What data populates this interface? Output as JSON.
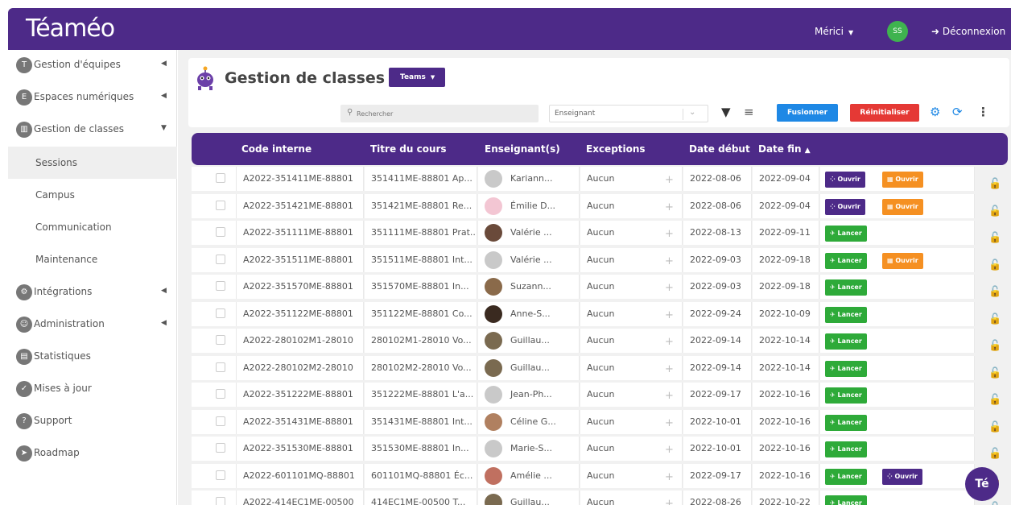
{
  "header": {
    "logo": "Téaméo",
    "user": "Mérici",
    "avatar_initials": "SS",
    "logout": "Déconnexion"
  },
  "sidebar": {
    "items": [
      {
        "label": "Gestion d'équipes",
        "icon": "team-icon"
      },
      {
        "label": "Espaces numériques",
        "icon": "spaces-icon"
      },
      {
        "label": "Gestion de classes",
        "icon": "class-icon"
      },
      {
        "label": "Sessions"
      },
      {
        "label": "Campus"
      },
      {
        "label": "Communication"
      },
      {
        "label": "Maintenance"
      },
      {
        "label": "Intégrations",
        "icon": "integrations-icon"
      },
      {
        "label": "Administration",
        "icon": "user-icon"
      },
      {
        "label": "Statistiques",
        "icon": "stats-icon"
      },
      {
        "label": "Mises à jour",
        "icon": "check-icon"
      },
      {
        "label": "Support",
        "icon": "help-icon"
      },
      {
        "label": "Roadmap",
        "icon": "roadmap-icon"
      }
    ]
  },
  "toolbar": {
    "title": "Gestion de classes",
    "teams_label": "Teams",
    "search_placeholder": "Rechercher",
    "teacher_select": "Enseignant",
    "merge_label": "Fusionner",
    "reset_label": "Réinitialiser"
  },
  "table": {
    "headers": [
      "Code interne",
      "Titre du cours",
      "Enseignant(s)",
      "Exceptions",
      "Date début",
      "Date fin"
    ],
    "sort_indicator": "▲",
    "rows": [
      {
        "code": "A2022-351411ME-88801",
        "title": "351411ME-88801 Ap...",
        "teacher": "Kariann...",
        "exc": "Aucun",
        "start": "2022-08-06",
        "end": "2022-09-04",
        "actions": [
          {
            "label": "Ouvrir",
            "kind": "purple"
          },
          {
            "label": "Ouvrir",
            "kind": "orange"
          }
        ]
      },
      {
        "code": "A2022-351421ME-88801",
        "title": "351421ME-88801 Re...",
        "teacher": "Émilie D...",
        "exc": "Aucun",
        "start": "2022-08-06",
        "end": "2022-09-04",
        "actions": [
          {
            "label": "Ouvrir",
            "kind": "purple"
          },
          {
            "label": "Ouvrir",
            "kind": "orange"
          }
        ]
      },
      {
        "code": "A2022-351111ME-88801",
        "title": "351111ME-88801 Prat...",
        "teacher": "Valérie ...",
        "exc": "Aucun",
        "start": "2022-08-13",
        "end": "2022-09-11",
        "actions": [
          {
            "label": "Lancer",
            "kind": "green"
          }
        ]
      },
      {
        "code": "A2022-351511ME-88801",
        "title": "351511ME-88801 Int...",
        "teacher": "Valérie ...",
        "exc": "Aucun",
        "start": "2022-09-03",
        "end": "2022-09-18",
        "actions": [
          {
            "label": "Lancer",
            "kind": "green"
          },
          {
            "label": "Ouvrir",
            "kind": "orange"
          }
        ]
      },
      {
        "code": "A2022-351570ME-88801",
        "title": "351570ME-88801 In...",
        "teacher": "Suzann...",
        "exc": "Aucun",
        "start": "2022-09-03",
        "end": "2022-09-18",
        "actions": [
          {
            "label": "Lancer",
            "kind": "green"
          }
        ]
      },
      {
        "code": "A2022-351122ME-88801",
        "title": "351122ME-88801 Co...",
        "teacher": "Anne-S...",
        "exc": "Aucun",
        "start": "2022-09-24",
        "end": "2022-10-09",
        "actions": [
          {
            "label": "Lancer",
            "kind": "green"
          }
        ]
      },
      {
        "code": "A2022-280102M1-28010",
        "title": "280102M1-28010 Vo...",
        "teacher": "Guillau...",
        "exc": "Aucun",
        "start": "2022-09-14",
        "end": "2022-10-14",
        "actions": [
          {
            "label": "Lancer",
            "kind": "green"
          }
        ]
      },
      {
        "code": "A2022-280102M2-28010",
        "title": "280102M2-28010 Vo...",
        "teacher": "Guillau...",
        "exc": "Aucun",
        "start": "2022-09-14",
        "end": "2022-10-14",
        "actions": [
          {
            "label": "Lancer",
            "kind": "green"
          }
        ]
      },
      {
        "code": "A2022-351222ME-88801",
        "title": "351222ME-88801 L'a...",
        "teacher": "Jean-Ph...",
        "exc": "Aucun",
        "start": "2022-09-17",
        "end": "2022-10-16",
        "actions": [
          {
            "label": "Lancer",
            "kind": "green"
          }
        ]
      },
      {
        "code": "A2022-351431ME-88801",
        "title": "351431ME-88801 Int...",
        "teacher": "Céline G...",
        "exc": "Aucun",
        "start": "2022-10-01",
        "end": "2022-10-16",
        "actions": [
          {
            "label": "Lancer",
            "kind": "green"
          }
        ]
      },
      {
        "code": "A2022-351530ME-88801",
        "title": "351530ME-88801 In...",
        "teacher": "Marie-S...",
        "exc": "Aucun",
        "start": "2022-10-01",
        "end": "2022-10-16",
        "actions": [
          {
            "label": "Lancer",
            "kind": "green"
          }
        ]
      },
      {
        "code": "A2022-601101MQ-88801",
        "title": "601101MQ-88801 Éc...",
        "teacher": "Amélie ...",
        "exc": "Aucun",
        "start": "2022-09-17",
        "end": "2022-10-16",
        "actions": [
          {
            "label": "Lancer",
            "kind": "green"
          },
          {
            "label": "Ouvrir",
            "kind": "purple"
          }
        ]
      },
      {
        "code": "A2022-414EC1ME-00500",
        "title": "414EC1ME-00500 T...",
        "teacher": "Guillau...",
        "exc": "Aucun",
        "start": "2022-08-26",
        "end": "2022-10-22",
        "actions": [
          {
            "label": "Lancer",
            "kind": "green"
          }
        ]
      }
    ]
  },
  "fab_label": "Té",
  "colors": {
    "brand": "#4d2a88",
    "green": "#2eaa39",
    "orange": "#f59022",
    "blue": "#1e88e5",
    "red": "#e53935"
  }
}
